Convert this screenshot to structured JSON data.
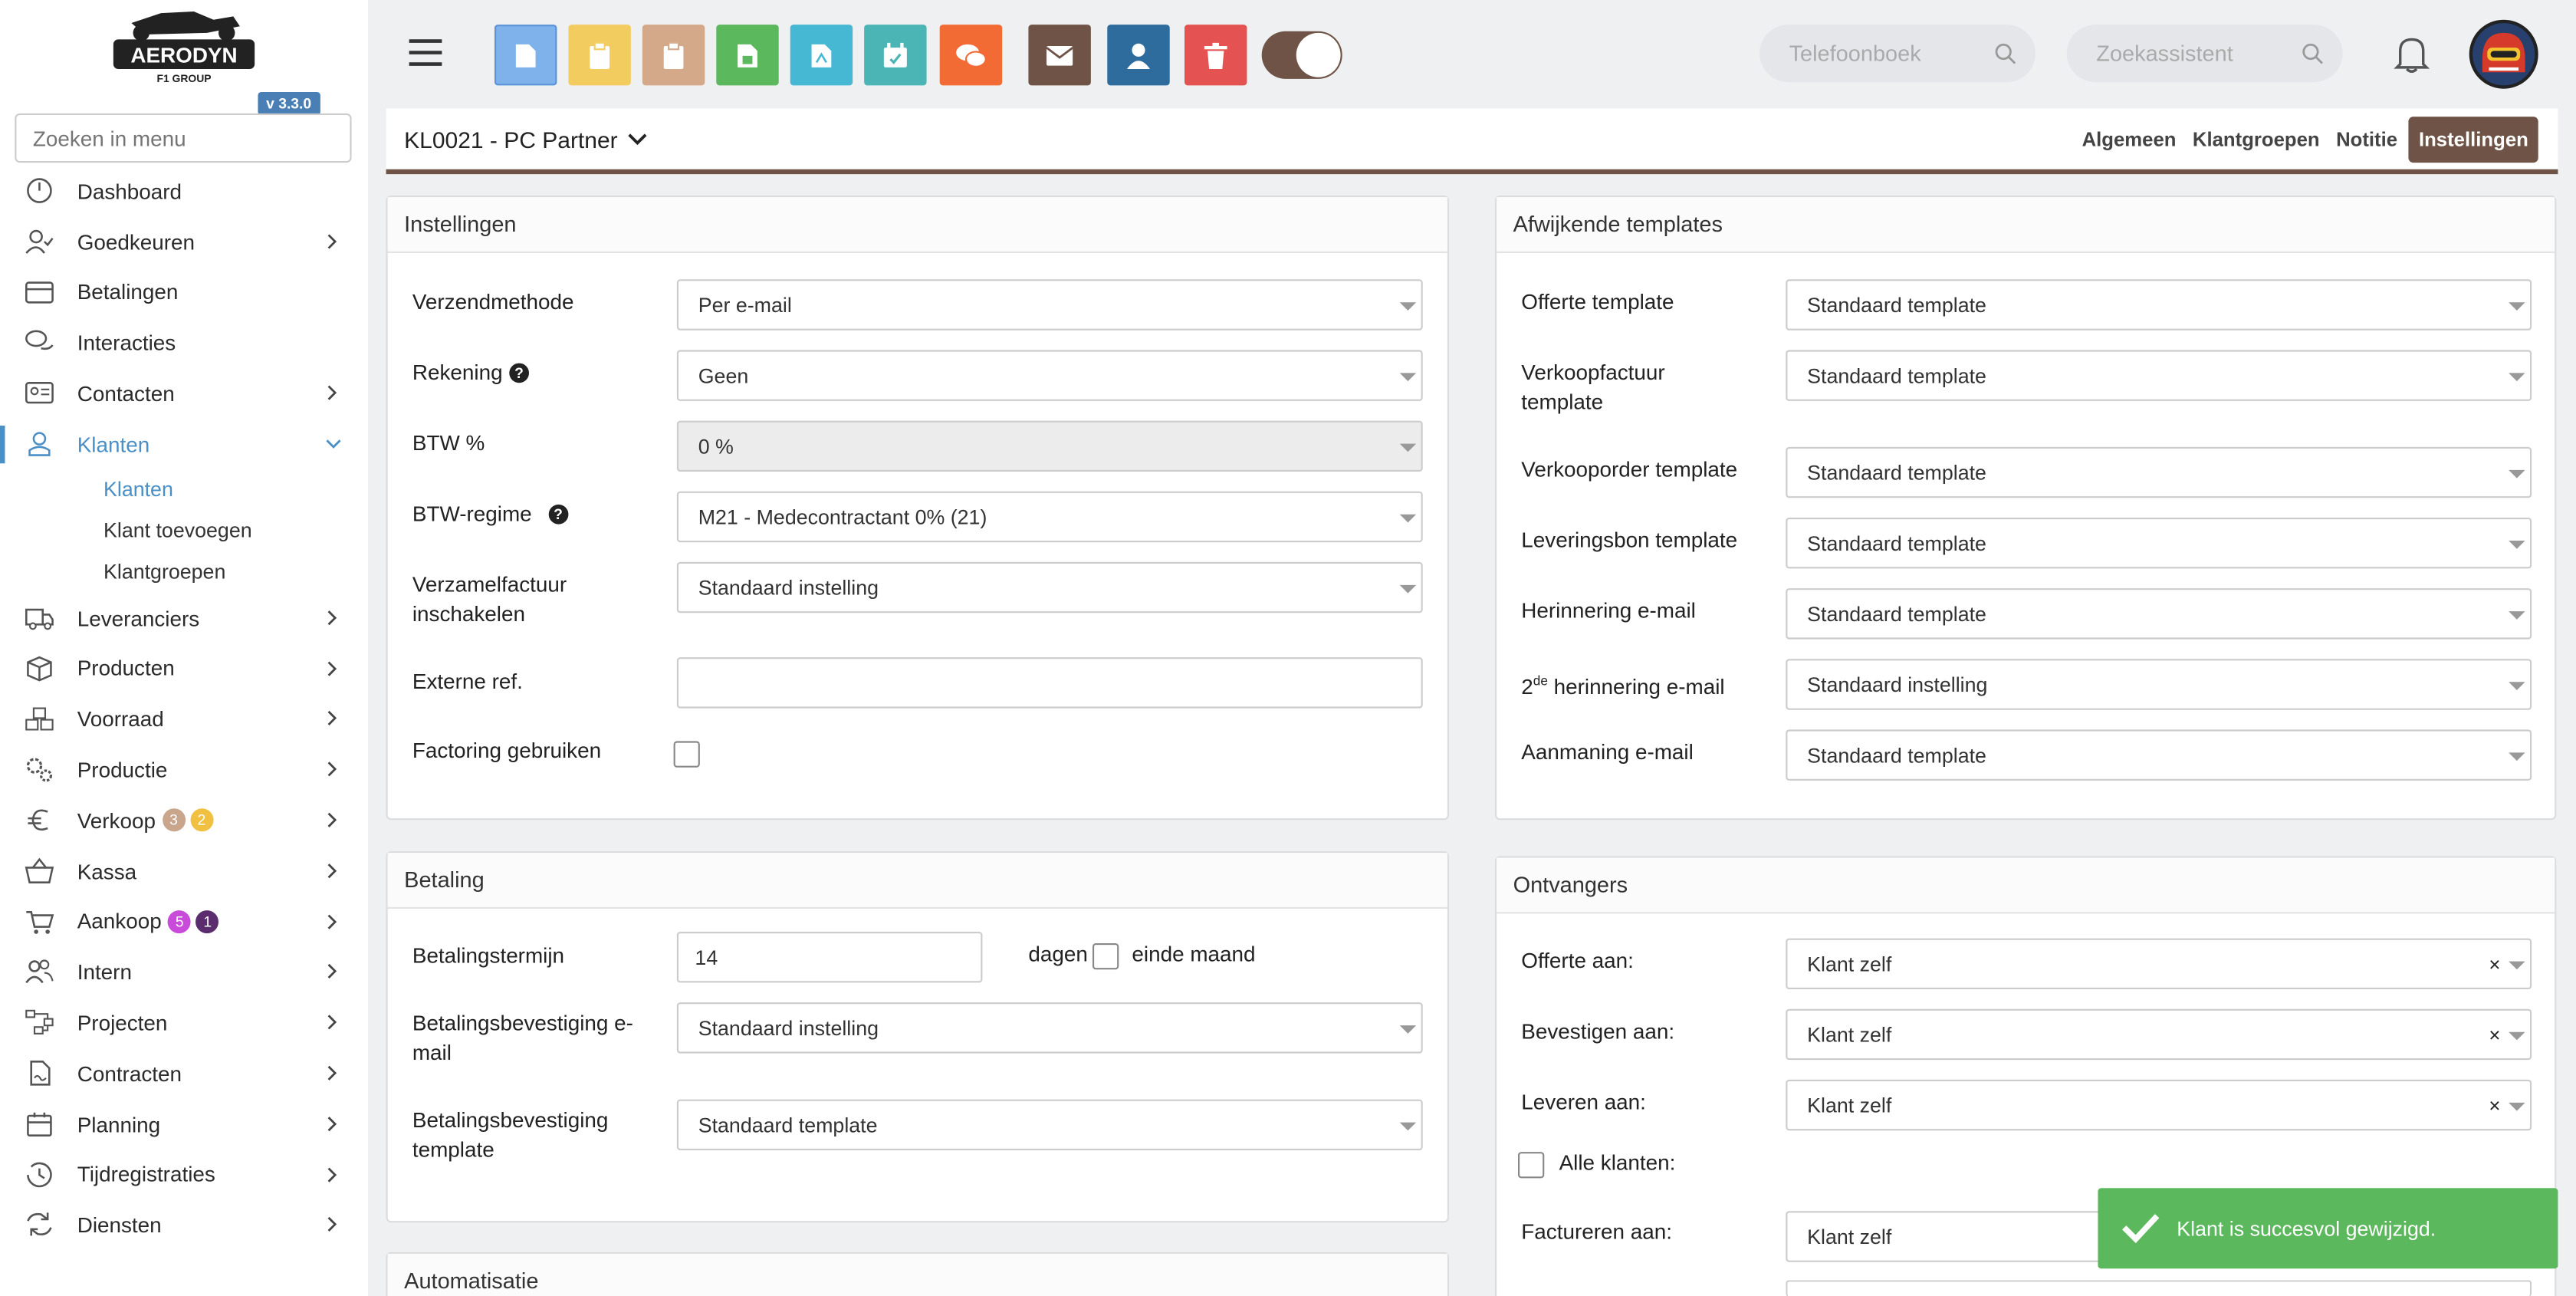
{
  "app": {
    "version": "v 3.3.0",
    "logo_text": "AERODYN",
    "logo_sub": "F1 GROUP"
  },
  "sidebar": {
    "search_placeholder": "Zoeken in menu",
    "items": [
      {
        "label": "Dashboard",
        "icon": "dashboard-icon"
      },
      {
        "label": "Goedkeuren",
        "icon": "user-check-icon"
      },
      {
        "label": "Betalingen",
        "icon": "credit-card-icon"
      },
      {
        "label": "Interacties",
        "icon": "chat-bubbles-icon"
      },
      {
        "label": "Contacten",
        "icon": "contact-card-icon"
      },
      {
        "label": "Klanten",
        "icon": "customer-icon",
        "active": true
      },
      {
        "label": "Leveranciers",
        "icon": "truck-icon"
      },
      {
        "label": "Producten",
        "icon": "box-icon"
      },
      {
        "label": "Voorraad",
        "icon": "stock-icon"
      },
      {
        "label": "Productie",
        "icon": "gears-icon"
      },
      {
        "label": "Verkoop",
        "icon": "euro-icon",
        "badges": [
          "3",
          "2"
        ]
      },
      {
        "label": "Kassa",
        "icon": "basket-icon"
      },
      {
        "label": "Aankoop",
        "icon": "cart-icon",
        "badges": [
          "5",
          "1"
        ]
      },
      {
        "label": "Intern",
        "icon": "users-icon"
      },
      {
        "label": "Projecten",
        "icon": "project-icon"
      },
      {
        "label": "Contracten",
        "icon": "contract-icon"
      },
      {
        "label": "Planning",
        "icon": "calendar-icon"
      },
      {
        "label": "Tijdregistraties",
        "icon": "clock-icon"
      },
      {
        "label": "Diensten",
        "icon": "refresh-icon"
      }
    ],
    "subitems": [
      {
        "label": "Klanten",
        "active": true
      },
      {
        "label": "Klant toevoegen"
      },
      {
        "label": "Klantgroepen"
      }
    ]
  },
  "topbar": {
    "buttons": [
      {
        "name": "document-icon",
        "color": "#7fb1ea"
      },
      {
        "name": "clipboard-icon",
        "color": "#f3cc60"
      },
      {
        "name": "clipboard-alt-icon",
        "color": "#d4a98a"
      },
      {
        "name": "spreadsheet-icon",
        "color": "#5cb85c"
      },
      {
        "name": "pdf-icon",
        "color": "#47b8d4"
      },
      {
        "name": "calendar-check-icon",
        "color": "#4bb5b5"
      },
      {
        "name": "comments-icon",
        "color": "#f26b35"
      },
      {
        "name": "envelope-icon",
        "color": "#6e5346"
      },
      {
        "name": "user-icon",
        "color": "#2d6c9c"
      },
      {
        "name": "trash-icon",
        "color": "#e55252"
      }
    ],
    "search1_placeholder": "Telefoonboek",
    "search2_placeholder": "Zoekassistent"
  },
  "header": {
    "title": "KL0021 - PC Partner",
    "tabs": [
      "Algemeen",
      "Klantgroepen",
      "Notitie",
      "Instellingen"
    ],
    "active_tab": "Instellingen"
  },
  "instellingen": {
    "title": "Instellingen",
    "verzendmethode_label": "Verzendmethode",
    "verzendmethode_value": "Per e-mail",
    "rekening_label": "Rekening",
    "rekening_value": "Geen",
    "btw_label": "BTW %",
    "btw_value": "0 %",
    "btwregime_label": "BTW-regime",
    "btwregime_value": "M21 - Medecontractant 0% (21)",
    "verzamel_label_1": "Verzamelfactuur",
    "verzamel_label_2": "inschakelen",
    "verzamel_value": "Standaard instelling",
    "externe_label": "Externe ref.",
    "externe_value": "",
    "factoring_label": "Factoring gebruiken"
  },
  "betaling": {
    "title": "Betaling",
    "termijn_label": "Betalingstermijn",
    "termijn_value": "14",
    "dagen": "dagen",
    "einde_maand": "einde maand",
    "bev_email_label_1": "Betalingsbevestiging e-",
    "bev_email_label_2": "mail",
    "bev_email_value": "Standaard instelling",
    "bev_tpl_label_1": "Betalingsbevestiging",
    "bev_tpl_label_2": "template",
    "bev_tpl_value": "Standaard template"
  },
  "automatisatie": {
    "title": "Automatisatie"
  },
  "templates": {
    "title": "Afwijkende templates",
    "rows": [
      {
        "label1": "Offerte template",
        "label2": "",
        "value": "Standaard template"
      },
      {
        "label1": "Verkoopfactuur",
        "label2": "template",
        "value": "Standaard template"
      },
      {
        "label1": "Verkooporder template",
        "label2": "",
        "value": "Standaard template"
      },
      {
        "label1": "Leveringsbon template",
        "label2": "",
        "value": "Standaard template"
      },
      {
        "label1": "Herinnering e-mail",
        "label2": "",
        "value": "Standaard template"
      },
      {
        "label1": "2",
        "sup": "de",
        "label_rest": " herinnering e-mail",
        "value": "Standaard instelling"
      },
      {
        "label1": "Aanmaning e-mail",
        "label2": "",
        "value": "Standaard template"
      }
    ]
  },
  "ontvangers": {
    "title": "Ontvangers",
    "offerte_label": "Offerte aan:",
    "offerte_value": "Klant zelf",
    "bevestigen_label": "Bevestigen aan:",
    "bevestigen_value": "Klant zelf",
    "leveren_label": "Leveren aan:",
    "leveren_value": "Klant zelf",
    "alle_label": "Alle klanten:",
    "factureren_label": "Factureren aan:",
    "factureren_value": "Klant zelf",
    "clear_symbol": "×"
  },
  "toast": {
    "message": "Klant is succesvol gewijzigd."
  }
}
